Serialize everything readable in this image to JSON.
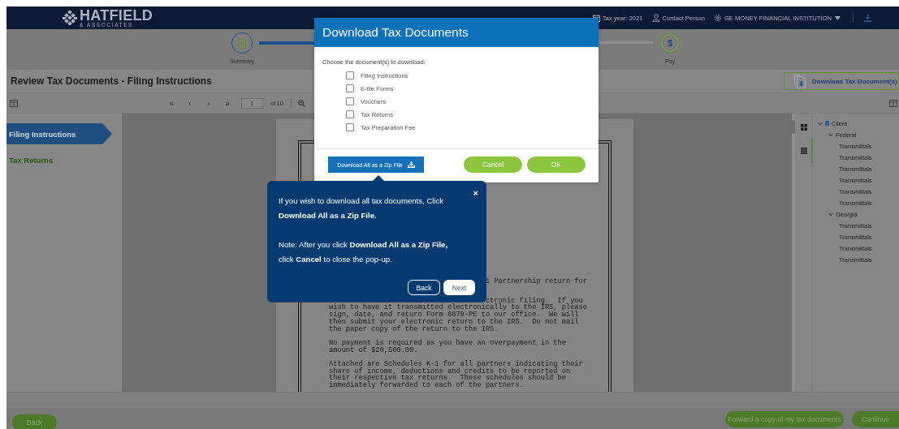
{
  "header": {
    "logo_name": "HATFIELD",
    "logo_tagline": "& ASSOCIATES",
    "tax_year": "Tax year: 2021",
    "contact": "Contact Person",
    "institution": "GE MONEY FINANCIAL INSTITUTION"
  },
  "steps": [
    {
      "label": "Summary",
      "completed": true
    },
    {
      "label": "Pay",
      "completed": false,
      "symbol": "$"
    }
  ],
  "page_title": "Review Tax Documents - Filing Instructions",
  "download_button": "Download Tax Document(s)",
  "pager": {
    "first": "«",
    "prev": "‹",
    "next": "›",
    "last": "»",
    "page": "1",
    "of": "of 10"
  },
  "sidebar": {
    "items": [
      {
        "label": "Filing Instructions",
        "selected": true
      },
      {
        "label": "Tax Returns",
        "selected": false
      }
    ]
  },
  "document": {
    "paragraphs": [
      [
        "1 Partnership return for"
      ],
      [
        "ctronic filing.  If you",
        "wish to have it transmitted electronically to the IRS, please",
        "sign, date, and return Form 8879-PE to our office.  We will",
        "then submit your electronic return to the IRS.  Do not mail",
        "the paper copy of the return to the IRS."
      ],
      [
        "No payment is required as you have an overpayment in the",
        "amount of $20,500.00."
      ],
      [
        "Attached are Schedules K-1 for all partners indicating their",
        "share of income, deductions and credits to be reported on",
        "their respective tax returns.  These schedules should be",
        "immediately forwarded to each of the partners."
      ]
    ]
  },
  "tree": {
    "label": "Client",
    "expanded": true,
    "children": [
      {
        "label": "Federal",
        "expanded": true,
        "children": [
          {
            "label": "Transmittals"
          },
          {
            "label": "Transmittals"
          },
          {
            "label": "Transmittals"
          },
          {
            "label": "Transmittals"
          },
          {
            "label": "Transmittals"
          },
          {
            "label": "Transmittals"
          }
        ]
      },
      {
        "label": "Georgia",
        "expanded": true,
        "children": [
          {
            "label": "Transmittals"
          },
          {
            "label": "Transmittals"
          },
          {
            "label": "Transmittals"
          },
          {
            "label": "Transmittals"
          }
        ]
      }
    ]
  },
  "footer": {
    "back": "Back",
    "forward": "Forward a copy of my tax documents",
    "continue": "Continue"
  },
  "dialog": {
    "title": "Download Tax Documents",
    "prompt": "Choose the document(s) to download:",
    "options": [
      {
        "label": "Filing Instructions",
        "checked": false
      },
      {
        "label": "E-file Forms",
        "checked": false
      },
      {
        "label": "Vouchers",
        "checked": false
      },
      {
        "label": "Tax Returns",
        "checked": false
      },
      {
        "label": "Tax Preparation Fee",
        "checked": false
      }
    ],
    "zip_button": "Download All as a Zip File",
    "cancel": "Cancel",
    "ok": "OK"
  },
  "tour_tip": {
    "close": "×",
    "paragraphs": [
      "If you wish to download all tax documents, Click **Download All as a Zip File.**",
      "Note: After you click **Download All as a Zip File,** click **Cancel** to close the pop-up."
    ],
    "back": "Back",
    "next": "Next"
  }
}
